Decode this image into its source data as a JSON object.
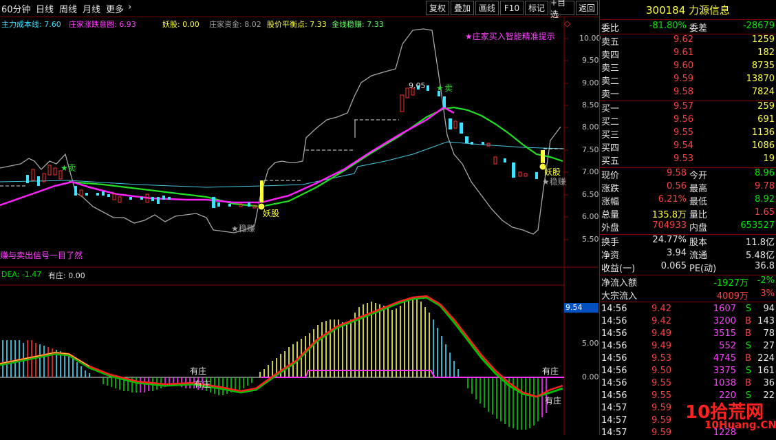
{
  "toolbar": {
    "period": "60分钟",
    "tabs": [
      "日线",
      "周线",
      "月线",
      "更多"
    ],
    "more_arrow": "›",
    "buttons": [
      "复权",
      "叠加",
      "画线",
      "F10",
      "标记",
      "+自选",
      "返回"
    ]
  },
  "indicators": {
    "cost_line": "主力成本线: 7.60",
    "rise_chart": "庄家涨跌意图: 6.93",
    "yaogu": "妖股: 0.00",
    "fund": "庄家资金: 8.02",
    "balance": "股价平衡点: 7.33",
    "gold": "金线稳赚: 7.33"
  },
  "price_chart": {
    "hint": "★庄家买入智能精准提示",
    "bottom_note": "赚与卖出信号一目了然",
    "y_ticks": [
      "10.00",
      "9.50",
      "9.00",
      "8.50",
      "8.00",
      "7.50",
      "7.00",
      "6.50",
      "6.00",
      "5.50"
    ],
    "marks": {
      "sell1": "★卖",
      "sell2": "卖",
      "high_price": "9.05",
      "yaogu1": "妖股",
      "yaogu2": "妖股",
      "wenzhuan1": "★稳赚",
      "wenzhuan2": "★稳赚"
    },
    "marker_glyph": "◇"
  },
  "macd": {
    "dea": "DEA: -1.47",
    "youzhuang": "有庄: 0.00",
    "y_ticks": [
      "5.00",
      "0.00"
    ],
    "current_value": "9.54",
    "labels": [
      "有庄",
      "有庄",
      "有庄",
      "有庄"
    ]
  },
  "colors": {
    "up": "#ff3030",
    "down": "#40e0ff",
    "green_line": "#00e000",
    "magenta_line": "#ff20ff",
    "gray_band": "#a0a0a0",
    "yellow": "#ffff40"
  },
  "stock": {
    "code": "300184",
    "name": "力源信息",
    "title": "300184 力源信息"
  },
  "order_book": {
    "weibi_label": "委比",
    "weibi_value": "-81.80%",
    "weicha_label": "委差",
    "weicha_value": "-28679",
    "asks": [
      {
        "label": "卖五",
        "price": "9.62",
        "vol": "1259"
      },
      {
        "label": "卖四",
        "price": "9.61",
        "vol": "182"
      },
      {
        "label": "卖三",
        "price": "9.60",
        "vol": "8735"
      },
      {
        "label": "卖二",
        "price": "9.59",
        "vol": "13870"
      },
      {
        "label": "卖一",
        "price": "9.58",
        "vol": "7824"
      }
    ],
    "bids": [
      {
        "label": "买一",
        "price": "9.57",
        "vol": "259"
      },
      {
        "label": "买二",
        "price": "9.56",
        "vol": "691"
      },
      {
        "label": "买三",
        "price": "9.55",
        "vol": "1136"
      },
      {
        "label": "买四",
        "price": "9.54",
        "vol": "1086"
      },
      {
        "label": "买五",
        "price": "9.53",
        "vol": "19"
      }
    ]
  },
  "quote": [
    {
      "l1": "现价",
      "v1": "9.58",
      "c1": "red",
      "l2": "今开",
      "v2": "8.96",
      "c2": "grn"
    },
    {
      "l1": "涨跌",
      "v1": "0.56",
      "c1": "red",
      "l2": "最高",
      "v2": "9.78",
      "c2": "red"
    },
    {
      "l1": "涨幅",
      "v1": "6.21%",
      "c1": "red",
      "l2": "最低",
      "v2": "8.92",
      "c2": "grn"
    },
    {
      "l1": "总量",
      "v1": "135.8万",
      "c1": "yel",
      "l2": "量比",
      "v2": "1.65",
      "c2": "red"
    },
    {
      "l1": "外盘",
      "v1": "704933",
      "c1": "red",
      "l2": "内盘",
      "v2": "653527",
      "c2": "grn"
    }
  ],
  "fundamentals": [
    {
      "l1": "换手",
      "v1": "24.77%",
      "l2": "股本",
      "v2": "11.8亿"
    },
    {
      "l1": "净资",
      "v1": "3.94",
      "l2": "流通",
      "v2": "5.48亿"
    },
    {
      "l1": "收益(一)",
      "v1": "0.065",
      "l2": "PE(动)",
      "v2": "36.8"
    }
  ],
  "flows": [
    {
      "label": "净流入额",
      "value": "-1927万",
      "pct": "-2%",
      "color": "grn"
    },
    {
      "label": "大宗流入",
      "value": "4009万",
      "pct": "3%",
      "color": "red"
    }
  ],
  "ticks": [
    {
      "time": "14:56",
      "price": "9.42",
      "vol": "1607",
      "side": "S",
      "count": "94"
    },
    {
      "time": "14:56",
      "price": "9.42",
      "vol": "3200",
      "side": "B",
      "count": "143"
    },
    {
      "time": "14:56",
      "price": "9.49",
      "vol": "3515",
      "side": "B",
      "count": "78"
    },
    {
      "time": "14:56",
      "price": "9.49",
      "vol": "552",
      "side": "S",
      "count": "27"
    },
    {
      "time": "14:56",
      "price": "9.53",
      "vol": "4745",
      "side": "B",
      "count": "224"
    },
    {
      "time": "14:56",
      "price": "9.50",
      "vol": "3375",
      "side": "S",
      "count": "161"
    },
    {
      "time": "14:56",
      "price": "9.55",
      "vol": "1038",
      "side": "B",
      "count": "36"
    },
    {
      "time": "14:56",
      "price": "9.55",
      "vol": "220",
      "side": "S",
      "count": "22"
    },
    {
      "time": "14:57",
      "price": "9.59",
      "vol": "",
      "side": "",
      "count": ""
    },
    {
      "time": "14:57",
      "price": "9.59",
      "vol": "",
      "side": "",
      "count": ""
    },
    {
      "time": "14:57",
      "price": "9.59",
      "vol": "1228",
      "side": "",
      "count": ""
    }
  ],
  "watermark": {
    "line1": "10拾荒网",
    "line2": "10Huang.CN"
  }
}
